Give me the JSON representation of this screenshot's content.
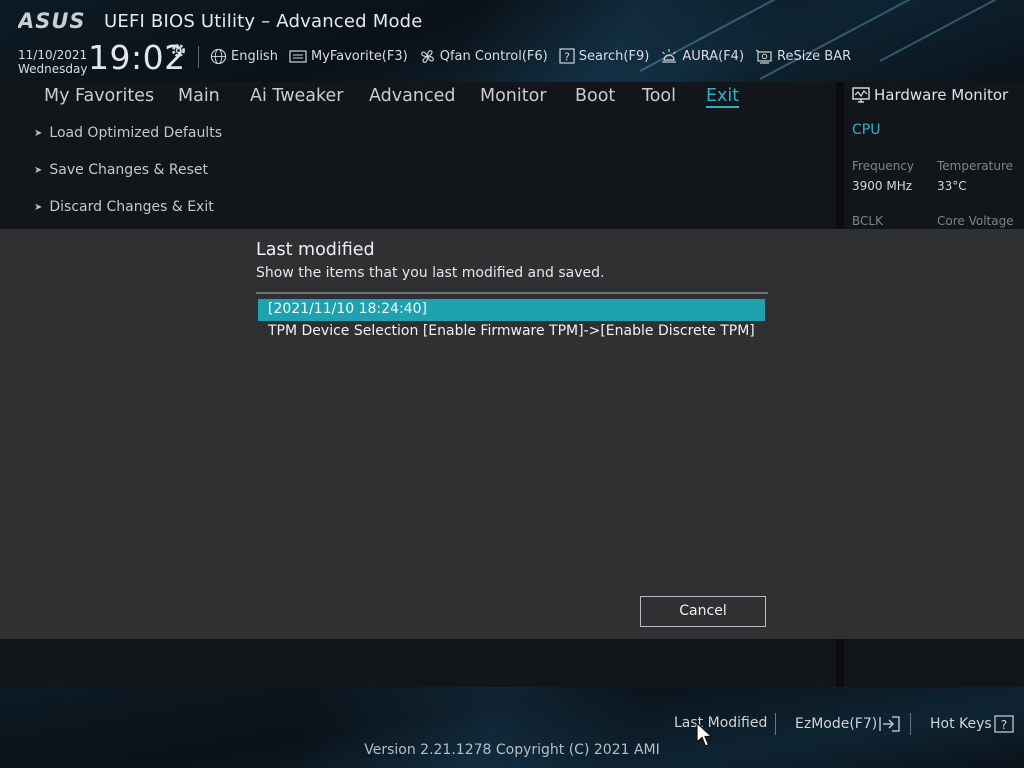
{
  "header": {
    "logo_text": "ASUS",
    "title": "UEFI BIOS Utility – Advanced Mode",
    "date": "11/10/2021",
    "weekday": "Wednesday",
    "time": "19:02",
    "toolbar": [
      {
        "label": "English",
        "icon": "globe-icon"
      },
      {
        "label": "MyFavorite(F3)",
        "icon": "favorite-icon"
      },
      {
        "label": "Qfan Control(F6)",
        "icon": "fan-icon"
      },
      {
        "label": "Search(F9)",
        "icon": "search-icon"
      },
      {
        "label": "AURA(F4)",
        "icon": "aura-icon"
      },
      {
        "label": "ReSize BAR",
        "icon": "resize-bar-icon"
      }
    ]
  },
  "menu": {
    "tabs": [
      "My Favorites",
      "Main",
      "Ai Tweaker",
      "Advanced",
      "Monitor",
      "Boot",
      "Tool",
      "Exit"
    ],
    "active": "Exit"
  },
  "exit_options": [
    "Load Optimized Defaults",
    "Save Changes & Reset",
    "Discard Changes & Exit"
  ],
  "hardware_monitor": {
    "title": "Hardware Monitor",
    "section": "CPU",
    "frequency_label": "Frequency",
    "frequency_value": "3900 MHz",
    "temperature_label": "Temperature",
    "temperature_value": "33°C",
    "bclk_label": "BCLK",
    "core_voltage_label": "Core Voltage"
  },
  "modal": {
    "title": "Last modified",
    "subtitle": "Show the items that you last modified and saved.",
    "entries": [
      "[2021/11/10 18:24:40]",
      "TPM Device Selection [Enable Firmware TPM]->[Enable Discrete TPM]"
    ],
    "cancel_label": "Cancel"
  },
  "footer": {
    "last_modified": "Last Modified",
    "ezmode": "EzMode(F7)",
    "hot_keys": "Hot Keys",
    "version": "Version 2.21.1278 Copyright (C) 2021 AMI"
  },
  "colors": {
    "accent": "#2fb2c8",
    "selected_row": "#1ea2af",
    "modal_bg": "#2f3032"
  }
}
